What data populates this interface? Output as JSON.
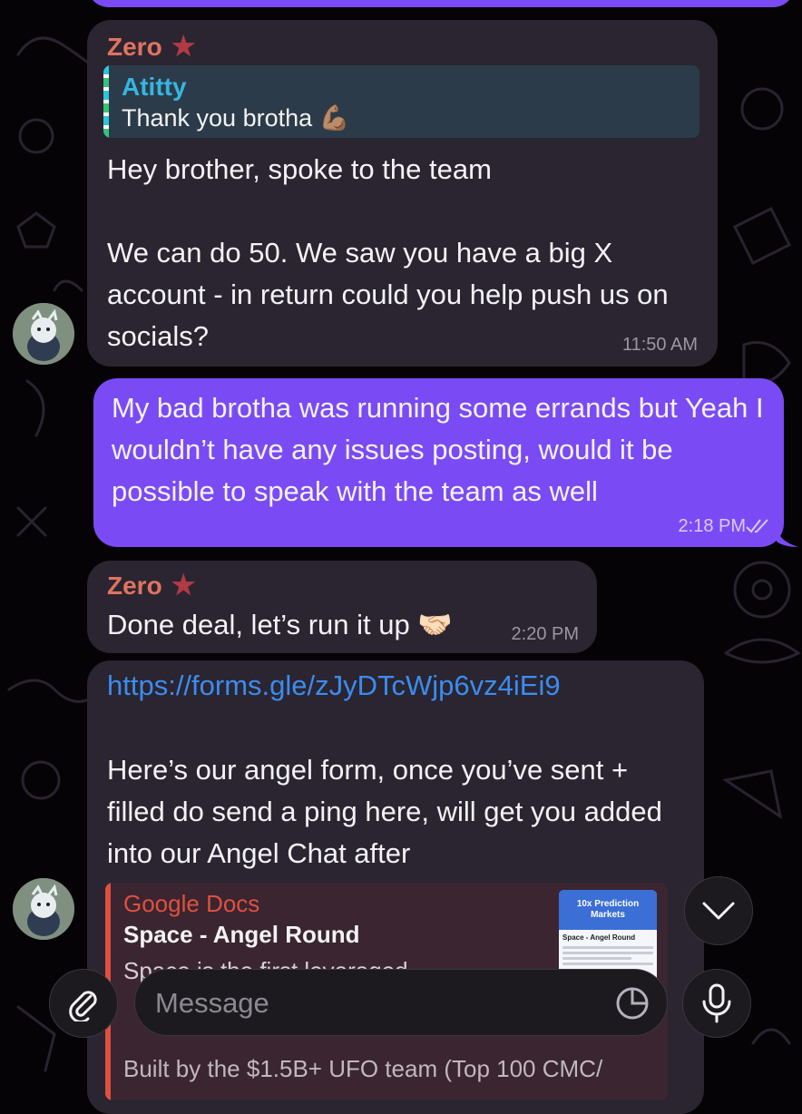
{
  "messages": [
    {
      "sender": "Zero",
      "reply": {
        "name": "Atitty",
        "text": "Thank you brotha 💪🏽"
      },
      "text": "Hey brother, spoke to the team\n\nWe can do 50. We saw you have a big X account - in return could you help push us on socials?",
      "time": "11:50 AM"
    },
    {
      "text": "My bad brotha was running some errands but Yeah I wouldn’t have any issues posting, would it be possible to speak with the team as well",
      "time": "2:18 PM"
    },
    {
      "sender": "Zero",
      "text": "Done deal, let’s run it up 🤝🏻",
      "time": "2:20 PM"
    },
    {
      "link": "https://forms.gle/zJyDTcWjp6vz4iEi9",
      "text": "Here’s our angel form, once you’ve sent + filled do send a ping here, will get you added into our Angel Chat after",
      "preview": {
        "site": "Google Docs",
        "title": "Space - Angel Round",
        "description": "Space is the first leveraged",
        "footer": "Built by the $1.5B+ UFO team (Top 100 CMC/",
        "thumb_heading": "10x Prediction Markets",
        "thumb_title": "Space - Angel Round"
      }
    }
  ],
  "composer": {
    "placeholder": "Message"
  },
  "icons": {
    "attach": "paperclip-icon",
    "sticker": "sticker-icon",
    "mic": "microphone-icon",
    "scroll_down": "chevron-down-icon",
    "read_receipt": "double-check-icon"
  },
  "colors": {
    "incoming_bubble": "#2a2530",
    "outgoing_bubble": "#7a4bf5",
    "sender_name": "#e0735f",
    "link": "#3b8cf0",
    "reply_name": "#35b6e0"
  }
}
